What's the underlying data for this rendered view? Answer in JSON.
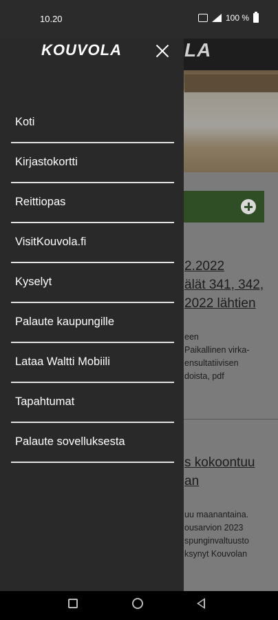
{
  "status_bar": {
    "time": "10.20",
    "battery": "100 %"
  },
  "drawer": {
    "logo": "KOUVOLA",
    "items": [
      {
        "label": "Koti"
      },
      {
        "label": "Kirjastokortti"
      },
      {
        "label": "Reittiopas"
      },
      {
        "label": "VisitKouvola.fi"
      },
      {
        "label": "Kyselyt"
      },
      {
        "label": "Palaute kaupungille"
      },
      {
        "label": "Lataa Waltti Mobiili"
      },
      {
        "label": "Tapahtumat"
      },
      {
        "label": "Palaute sovelluksesta"
      }
    ]
  },
  "background": {
    "logo_fragment": "LA",
    "article1": {
      "title_lines": [
        "2.2022",
        "älät 341, 342,",
        "2022 lähtien"
      ],
      "body_lines": [
        "een",
        "Paikallinen virka-",
        "ensultatiivisen",
        "doista, pdf"
      ]
    },
    "article2": {
      "title_lines": [
        "s kokoontuu",
        "an"
      ],
      "body_lines": [
        "uu maanantaina.",
        "ousarvion 2023",
        "spunginvaltuusto",
        "ksynyt Kouvolan"
      ]
    }
  }
}
